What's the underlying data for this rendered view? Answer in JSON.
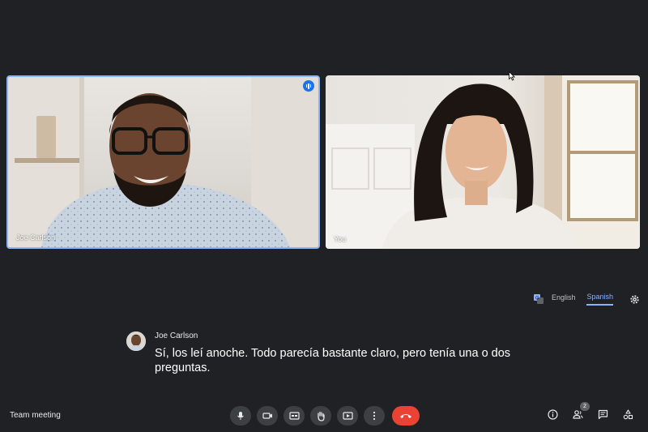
{
  "meeting": {
    "title": "Team meeting"
  },
  "participants": [
    {
      "name": "Joe Carlson",
      "speaking": true
    },
    {
      "name": "You",
      "speaking": false
    }
  ],
  "captions": {
    "languages": [
      "English",
      "Spanish"
    ],
    "selected_language": "Spanish",
    "speaker": "Joe Carlson",
    "text": "Sí, los leí anoche. Todo parecía bastante claro, pero tenía una o dos preguntas."
  },
  "people_count": "2",
  "controls": [
    {
      "icon": "mic-icon"
    },
    {
      "icon": "camera-icon"
    },
    {
      "icon": "closed-captions-icon"
    },
    {
      "icon": "raise-hand-icon"
    },
    {
      "icon": "present-screen-icon"
    },
    {
      "icon": "more-options-icon"
    },
    {
      "icon": "end-call-icon"
    }
  ],
  "right_icons": [
    "info-icon",
    "people-icon",
    "chat-icon",
    "activities-icon"
  ],
  "colors": {
    "background": "#202124",
    "accent": "#8ab4f8",
    "end_call": "#ea4335",
    "control_bg": "#3c4043"
  }
}
